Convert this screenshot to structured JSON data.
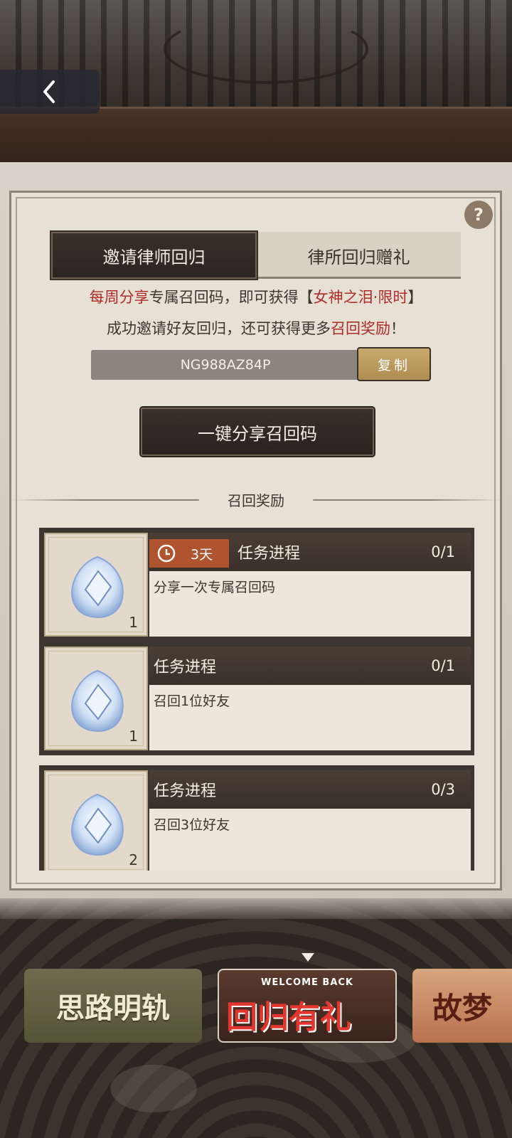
{
  "nav": {
    "back_icon": "chevron-left-icon"
  },
  "help": {
    "label": "?"
  },
  "tabs": [
    {
      "label": "邀请律师回归",
      "active": true
    },
    {
      "label": "律所回归赠礼",
      "active": false
    }
  ],
  "description": {
    "line1": {
      "red1": "每周分享",
      "mid": "专属召回码，即可获得【",
      "red2": "女神之泪·限时",
      "end": "】"
    },
    "line2": {
      "start": "成功邀请好友回归，还可获得更多",
      "red": "召回奖励",
      "end": "！"
    }
  },
  "code": {
    "value": "NG988AZ84P",
    "copy_label": "复制"
  },
  "share_button": {
    "label": "一键分享召回码"
  },
  "rewards_title": "召回奖励",
  "rewards": [
    {
      "count": "1",
      "timer": "3天",
      "task_label": "任务进程",
      "progress": "0/1",
      "desc": "分享一次专属召回码"
    },
    {
      "count": "1",
      "timer": "",
      "task_label": "任务进程",
      "progress": "0/1",
      "desc": "召回1位好友"
    },
    {
      "count": "2",
      "timer": "",
      "task_label": "任务进程",
      "progress": "0/3",
      "desc": "召回3位好友"
    }
  ],
  "banners": {
    "left": "思路明轨",
    "middle_sub": "WELCOME BACK",
    "middle": "回归有礼",
    "right": "故梦"
  },
  "colors": {
    "accent_red": "#b02a2a",
    "timer_orange": "#b0542f",
    "copy_gold": "#c8a96c"
  }
}
